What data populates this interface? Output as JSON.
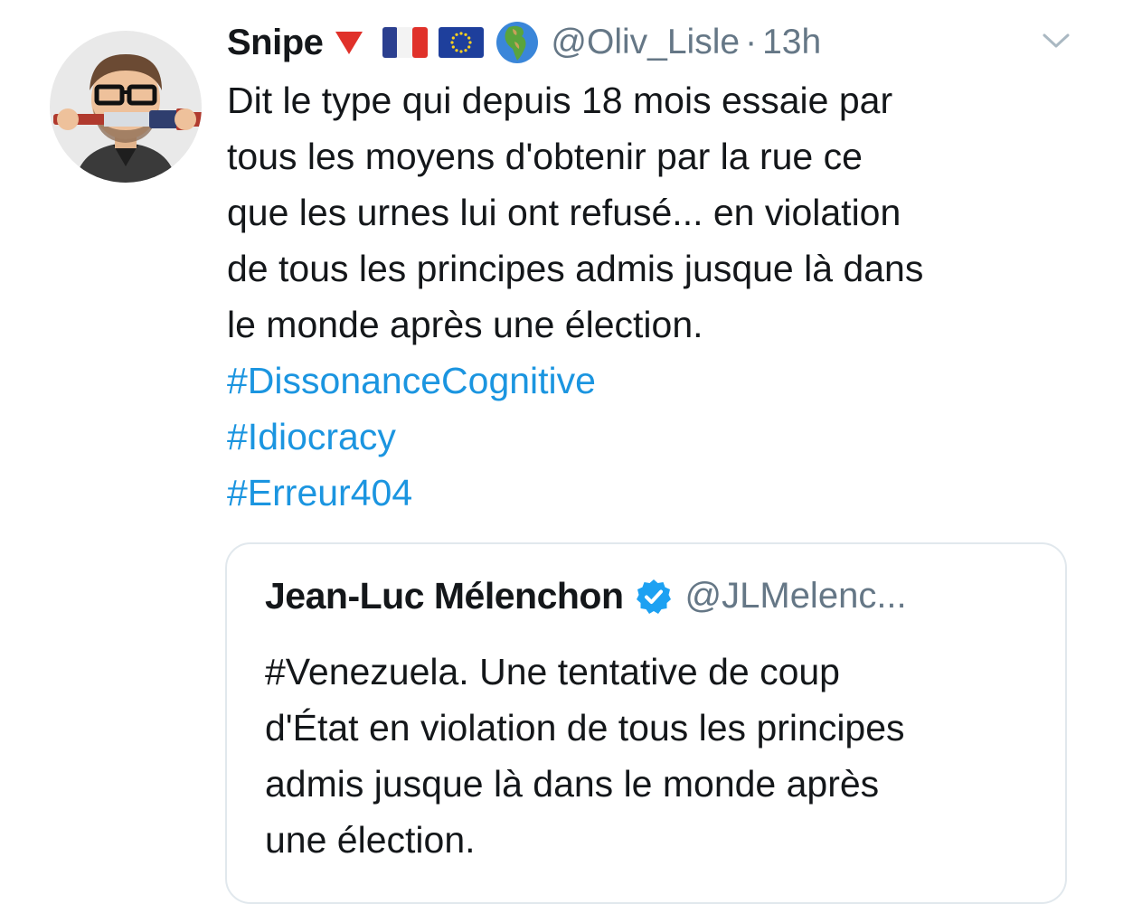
{
  "tweet": {
    "author": {
      "display_name": "Snipe",
      "handle": "@Oliv_Lisle",
      "avatar_icon": "bitmoji-avatar",
      "name_emojis": [
        "red-triangle-down-icon",
        "france-flag-icon",
        "eu-flag-icon",
        "globe-africa-europe-icon"
      ]
    },
    "separator": "·",
    "timestamp": "13h",
    "menu_icon": "chevron-down-icon",
    "text_lines": [
      "Dit le type qui depuis 18 mois essaie par",
      "tous les moyens d'obtenir par la rue ce",
      "que les urnes lui ont refusé... en violation",
      "de tous les principes admis jusque là dans",
      "le monde après une élection."
    ],
    "hashtags": [
      "#DissonanceCognitive",
      "#Idiocracy",
      "#Erreur404"
    ]
  },
  "quoted_tweet": {
    "author": {
      "display_name": "Jean-Luc Mélenchon",
      "verified_icon": "verified-badge-icon",
      "handle": "@JLMelenc..."
    },
    "text_lines": [
      "#Venezuela. Une tentative de coup",
      "d'État en violation de tous les principes",
      "admis jusque là dans le monde après",
      "une élection."
    ]
  },
  "colors": {
    "text_primary": "#14171a",
    "text_secondary": "#657786",
    "link": "#1b95e0",
    "border": "#e1e8ed",
    "verified": "#1da1f2"
  }
}
